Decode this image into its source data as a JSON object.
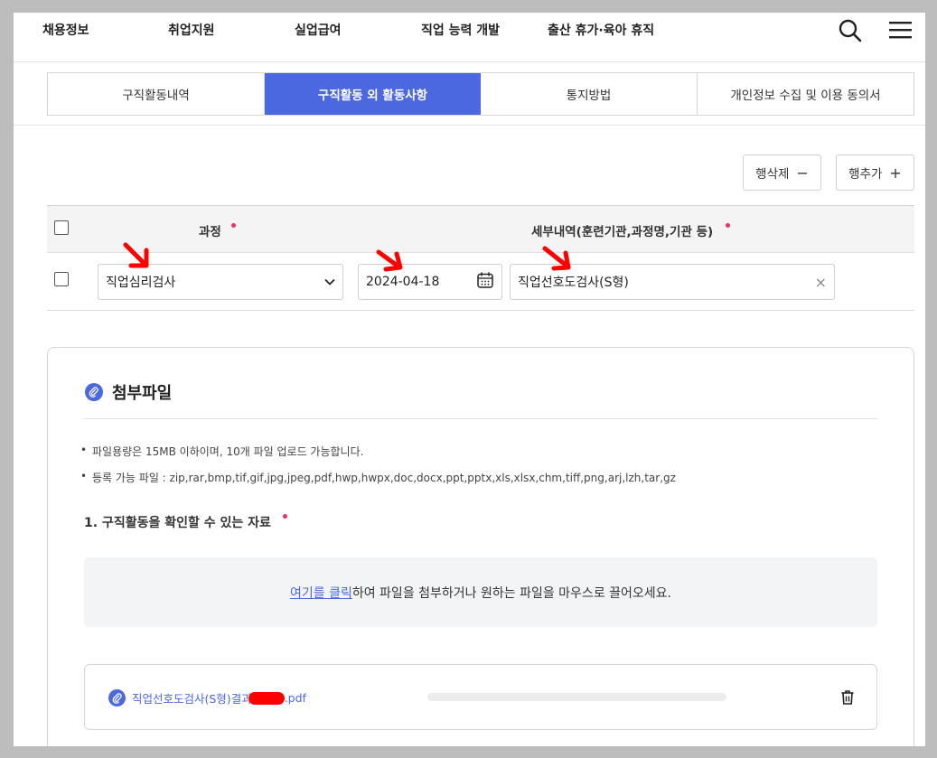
{
  "top_nav": {
    "items": [
      "채용정보",
      "취업지원",
      "실업급여",
      "직업 능력 개발",
      "출산 휴가·육아 휴직"
    ],
    "search_icon": "search-icon",
    "menu_icon": "hamburger-menu-icon"
  },
  "tabs": [
    {
      "label": "구직활동내역",
      "active": false
    },
    {
      "label": "구직활동 외 활동사항",
      "active": true
    },
    {
      "label": "통지방법",
      "active": false
    },
    {
      "label": "개인정보 수집 및 이용 동의서",
      "active": false
    }
  ],
  "row_actions": {
    "delete_label": "행삭제",
    "delete_symbol": "−",
    "add_label": "행추가",
    "add_symbol": "+"
  },
  "table": {
    "headers": [
      "과정",
      "세부내역(훈련기관,과정명,기관 등)"
    ],
    "rows": [
      {
        "course": "직업심리검사",
        "date": "2024-04-18",
        "detail": "직업선호도검사(S형)",
        "clear_symbol": "×"
      }
    ]
  },
  "attachments": {
    "title": "첨부파일",
    "notes": [
      "파일용량은 15MB 이하이며, 10개 파일 업로드 가능합니다.",
      "등록 가능 파일 : zip,rar,bmp,tif,gif,jpg,jpeg,pdf,hwp,hwpx,doc,docx,ppt,pptx,xls,xlsx,chm,tiff,png,arj,lzh,tar,gz"
    ],
    "section_label": "1. 구직활동을 확인할 수 있는 자료",
    "dropzone": {
      "link_text": "여기를 클릭",
      "rest_text": "하여 파일을 첨부하거나 원하는 파일을 마우스로 끌어오세요."
    },
    "file": {
      "name_prefix": "직업선호도검사(S형)결과",
      "name_suffix": ".pdf",
      "progress": 0
    }
  },
  "colors": {
    "accent": "#4c68e0",
    "required": "#e8326a",
    "annotation": "#ff0000"
  }
}
